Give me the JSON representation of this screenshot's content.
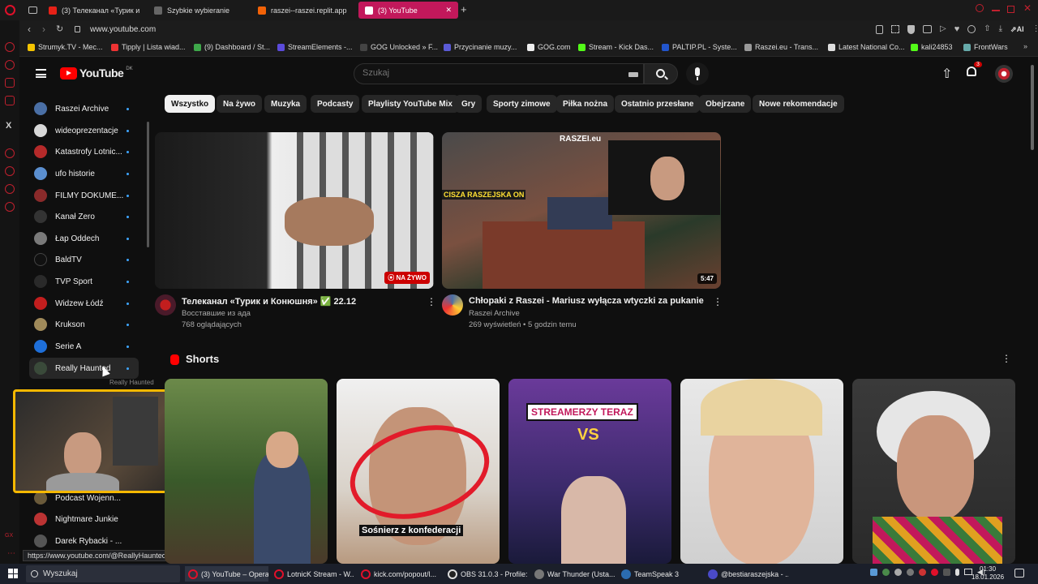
{
  "browser": {
    "tabs": [
      {
        "label": "(3) Телеканал «Турик и К",
        "color": "#e62117"
      },
      {
        "label": "Szybkie wybieranie",
        "color": "#888"
      },
      {
        "label": "raszei--raszei.replit.app",
        "color": "#f26207"
      },
      {
        "label": "(3) YouTube",
        "color": "#ff0000"
      }
    ],
    "url": "www.youtube.com",
    "bookmarks": [
      {
        "label": "Strumyk.TV - Mec...",
        "color": "#f5c400"
      },
      {
        "label": "Tipply | Lista wiad...",
        "color": "#e33"
      },
      {
        "label": "(9) Dashboard / St...",
        "color": "#3ea84a"
      },
      {
        "label": "StreamElements -...",
        "color": "#5b4bdb"
      },
      {
        "label": "GOG Unlocked » F...",
        "color": "#333"
      },
      {
        "label": "Przycinanie muzy...",
        "color": "#5a5ad6"
      },
      {
        "label": "GOG.com",
        "color": "#eee"
      },
      {
        "label": "Stream - Kick Das...",
        "color": "#53fc18"
      },
      {
        "label": "PALTIP.PL - Syste...",
        "color": "#2255cc"
      },
      {
        "label": "Raszei.eu - Trans...",
        "color": "#999"
      },
      {
        "label": "Latest National Co...",
        "color": "#ddd"
      },
      {
        "label": "kali24853",
        "color": "#53fc18"
      },
      {
        "label": "FrontWars",
        "color": "#6aa"
      }
    ]
  },
  "youtube": {
    "logo_text": "YouTube",
    "logo_badge": "DK",
    "search_placeholder": "Szukaj",
    "notification_count": "3",
    "chips": [
      "Wszystko",
      "Na żywo",
      "Muzyka",
      "Podcasty",
      "Playlisty YouTube Mix",
      "Gry",
      "Sporty zimowe",
      "Piłka nożna",
      "Ostatnio przesłane",
      "Obejrzane",
      "Nowe rekomendacje"
    ],
    "sidebar": [
      {
        "label": "Raszei Archive",
        "color": "#4a6fa5"
      },
      {
        "label": "wideoprezentacje",
        "color": "#d8d8d8"
      },
      {
        "label": "Katastrofy Lotnic...",
        "color": "#b52a2a"
      },
      {
        "label": "ufo historie",
        "color": "#5b8fd0"
      },
      {
        "label": "FILMY DOKUME...",
        "color": "#8a2a2a"
      },
      {
        "label": "Kanał Zero",
        "color": "#222"
      },
      {
        "label": "Łap Oddech",
        "color": "#7a7a7a"
      },
      {
        "label": "BaldTV",
        "color": "#111"
      },
      {
        "label": "TVP Sport",
        "color": "#1f1f1f"
      },
      {
        "label": "Widzew Łódź",
        "color": "#c21e1e"
      },
      {
        "label": "Krukson",
        "color": "#a08a5a"
      },
      {
        "label": "Serie A",
        "color": "#1e6fd9"
      },
      {
        "label": "Really Haunted",
        "color": "#3a4a3a"
      }
    ],
    "sidebar_bottom": [
      {
        "label": "Podcast Wojenn...",
        "color": "#6a5a3a"
      },
      {
        "label": "Nightmare Junkie",
        "color": "#b33"
      },
      {
        "label": "Darek Rybacki - ...",
        "color": "#555"
      }
    ],
    "tooltip": "Really Haunted",
    "status_url": "https://www.youtube.com/@ReallyHaunted",
    "videos": [
      {
        "title": "Телеканал «Турик и Конюшня» ✅ 22.12",
        "channel": "Восставшие из ада",
        "meta": "768 oglądających",
        "badge": "NA ŻYWO"
      },
      {
        "title": "Chłopaki z Raszei - Mariusz wyłącza wtyczki za pukanie",
        "channel": "Raszei Archive",
        "meta": "269 wyświetleń • 5 godzin temu",
        "duration": "5:47",
        "overlay_text": "CISZA RASZEJSKA ON",
        "overlay_brand": "RASZEI.eu"
      }
    ],
    "shorts_title": "Shorts",
    "shorts": [
      {
        "caption": ""
      },
      {
        "caption": "Sośnierz z konfederacji"
      },
      {
        "caption": "STREAMERZY TERAZ",
        "vs": "VS"
      },
      {
        "caption": ""
      },
      {
        "caption": ""
      }
    ]
  },
  "taskbar": {
    "search": "Wyszukaj",
    "items": [
      {
        "label": "(3) YouTube – Opera",
        "color": "#e0102a"
      },
      {
        "label": "LotnicK Stream - W...",
        "color": "#e0102a"
      },
      {
        "label": "kick.com/popout/l...",
        "color": "#e0102a"
      },
      {
        "label": "OBS 31.0.3 - Profile:...",
        "color": "#222"
      },
      {
        "label": "War Thunder (Usta...",
        "color": "#777"
      },
      {
        "label": "TeamSpeak 3",
        "color": "#2b6cb0"
      },
      {
        "label": "@bestiaraszejska - ...",
        "color": "#4a4ac8"
      }
    ],
    "time": "01:30",
    "date": "18.01.2026"
  }
}
